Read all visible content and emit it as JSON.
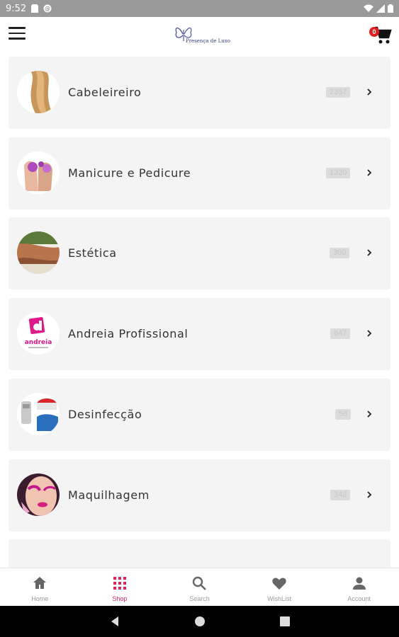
{
  "status_bar": {
    "time": "9:52"
  },
  "app_bar": {
    "logo_text": "Presença de Luxo",
    "cart_count": "0"
  },
  "categories": [
    {
      "name": "Cabeleireiro",
      "count": "2357",
      "icon": "hair-thumbnail"
    },
    {
      "name": "Manicure e Pedicure",
      "count": "1320",
      "icon": "manicure-thumbnail"
    },
    {
      "name": "Estética",
      "count": "300",
      "icon": "aesthetics-thumbnail"
    },
    {
      "name": "Andreia Profissional",
      "count": "647",
      "icon": "andreia-logo-thumbnail"
    },
    {
      "name": "Desinfecção",
      "count": "56",
      "icon": "disinfection-thumbnail"
    },
    {
      "name": "Maquilhagem",
      "count": "342",
      "icon": "makeup-thumbnail"
    }
  ],
  "bottom_nav": [
    {
      "label": "Home",
      "icon": "home-icon"
    },
    {
      "label": "Shop",
      "icon": "grid-icon",
      "active": true
    },
    {
      "label": "Search",
      "icon": "search-icon"
    },
    {
      "label": "WishList",
      "icon": "heart-icon"
    },
    {
      "label": "Account",
      "icon": "person-icon"
    }
  ],
  "colors": {
    "accent": "#e0245e",
    "status_bar": "#9a9a9a",
    "card_bg": "#f4f4f4",
    "badge": "#e02020"
  }
}
